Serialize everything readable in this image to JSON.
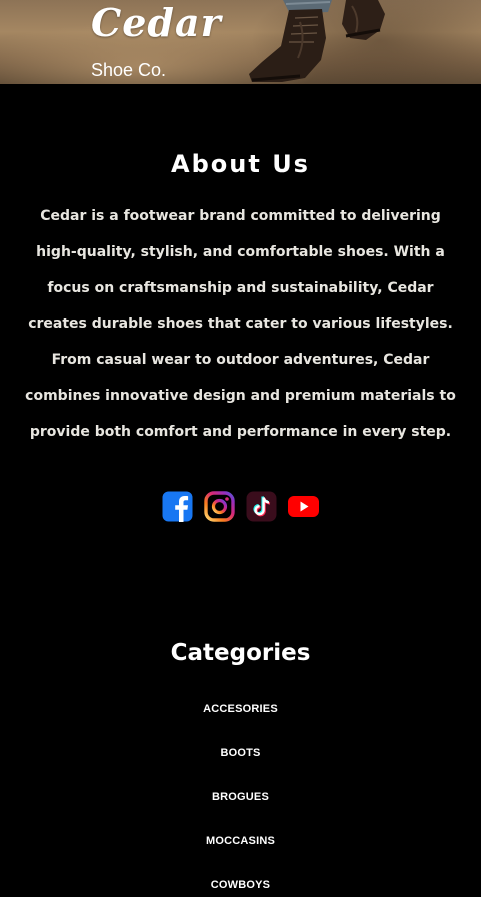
{
  "hero": {
    "brand_name": "Cedar",
    "brand_subtitle": "Shoe Co."
  },
  "about": {
    "title": "About Us",
    "text": "Cedar is a footwear brand committed to delivering high-quality, stylish, and comfortable shoes. With a focus on craftsmanship and sustainability, Cedar creates durable shoes that cater to various lifestyles. From casual wear to outdoor adventures, Cedar combines innovative design and premium materials to provide both comfort and performance in every step."
  },
  "social": [
    {
      "icon": "facebook-icon",
      "color": "#1877F2"
    },
    {
      "icon": "instagram-icon",
      "color": "#E1306C"
    },
    {
      "icon": "tiktok-icon",
      "color": "#25F4EE"
    },
    {
      "icon": "youtube-icon",
      "color": "#FF0000"
    }
  ],
  "categories": {
    "title": "Categories",
    "items": [
      "ACCESORIES",
      "BOOTS",
      "BROGUES",
      "MOCCASINS",
      "COWBOYS"
    ]
  },
  "colors": {
    "background": "#000000",
    "text": "#ffffff",
    "body_text": "#e8e6e0"
  }
}
